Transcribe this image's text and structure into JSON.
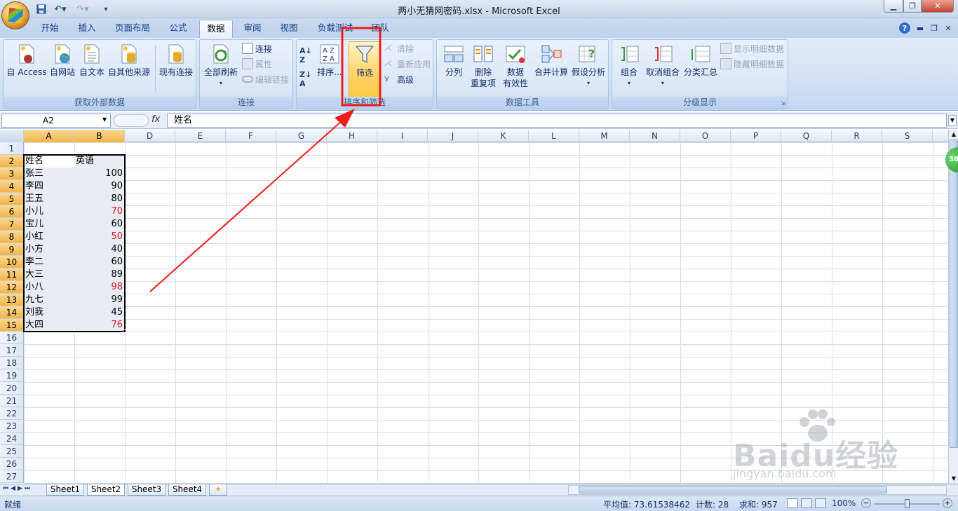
{
  "window": {
    "title": "两小无猜网密码.xlsx - Microsoft Excel"
  },
  "tabs": [
    "开始",
    "插入",
    "页面布局",
    "公式",
    "数据",
    "审阅",
    "视图",
    "负载测试",
    "团队"
  ],
  "active_tab": "数据",
  "ribbon": {
    "external": {
      "label": "获取外部数据",
      "access": "自 Access",
      "web": "自网站",
      "text": "自文本",
      "other": "自其他来源",
      "existing": "现有连接"
    },
    "connections": {
      "label": "连接",
      "refresh_all": "全部刷新",
      "connections": "连接",
      "properties": "属性",
      "edit_links": "编辑链接"
    },
    "sort_filter": {
      "label": "排序和筛选",
      "sort": "排序...",
      "filter": "筛选",
      "clear": "清除",
      "reapply": "重新应用",
      "advanced": "高级"
    },
    "data_tools": {
      "label": "数据工具",
      "text_to_cols": "分列",
      "remove_dup_1": "删除",
      "remove_dup_2": "重复项",
      "validation_1": "数据",
      "validation_2": "有效性",
      "consolidate": "合并计算",
      "what_if": "假设分析"
    },
    "outline": {
      "label": "分级显示",
      "group": "组合",
      "ungroup": "取消组合",
      "subtotal": "分类汇总",
      "show_detail": "显示明细数据",
      "hide_detail": "隐藏明细数据"
    }
  },
  "formula_bar": {
    "name_box": "A2",
    "fx": "fx",
    "formula": "姓名"
  },
  "columns": [
    "A",
    "B",
    "D",
    "E",
    "F",
    "G",
    "H",
    "I",
    "J",
    "K",
    "L",
    "M",
    "N",
    "O",
    "P",
    "Q",
    "R",
    "S"
  ],
  "rows": [
    "1",
    "2",
    "3",
    "4",
    "5",
    "6",
    "7",
    "8",
    "9",
    "10",
    "11",
    "12",
    "13",
    "14",
    "15",
    "16",
    "17",
    "18",
    "19",
    "20",
    "21",
    "22",
    "23",
    "24",
    "25",
    "26",
    "27"
  ],
  "table": {
    "headers": [
      "姓名",
      "英语"
    ],
    "rows": [
      {
        "name": "张三",
        "score": "100",
        "highlight": false
      },
      {
        "name": "李四",
        "score": "90",
        "highlight": false
      },
      {
        "name": "王五",
        "score": "80",
        "highlight": false
      },
      {
        "name": "小儿",
        "score": "70",
        "highlight": true
      },
      {
        "name": "宝儿",
        "score": "60",
        "highlight": false
      },
      {
        "name": "小红",
        "score": "50",
        "highlight": true
      },
      {
        "name": "小方",
        "score": "40",
        "highlight": false
      },
      {
        "name": "李二",
        "score": "60",
        "highlight": false
      },
      {
        "name": "大三",
        "score": "89",
        "highlight": false
      },
      {
        "name": "小八",
        "score": "98",
        "highlight": true
      },
      {
        "name": "九七",
        "score": "99",
        "highlight": false
      },
      {
        "name": "刘我",
        "score": "45",
        "highlight": false
      },
      {
        "name": "大四",
        "score": "76",
        "highlight": true
      }
    ]
  },
  "sheets": [
    "Sheet1",
    "Sheet2",
    "Sheet3",
    "Sheet4"
  ],
  "active_sheet": "Sheet2",
  "status": {
    "ready": "就绪",
    "average": "平均值: 73.61538462",
    "count": "计数: 28",
    "sum": "求和: 957",
    "zoom": "100%"
  },
  "side_badge": "38",
  "watermark": {
    "brand": "Baidu经验",
    "url": "jingyan.baidu.com"
  },
  "colors": {
    "highlight_red": "#d42020",
    "annotation_red": "#ee1c1c",
    "selection_fill": "#e8ecf4"
  }
}
